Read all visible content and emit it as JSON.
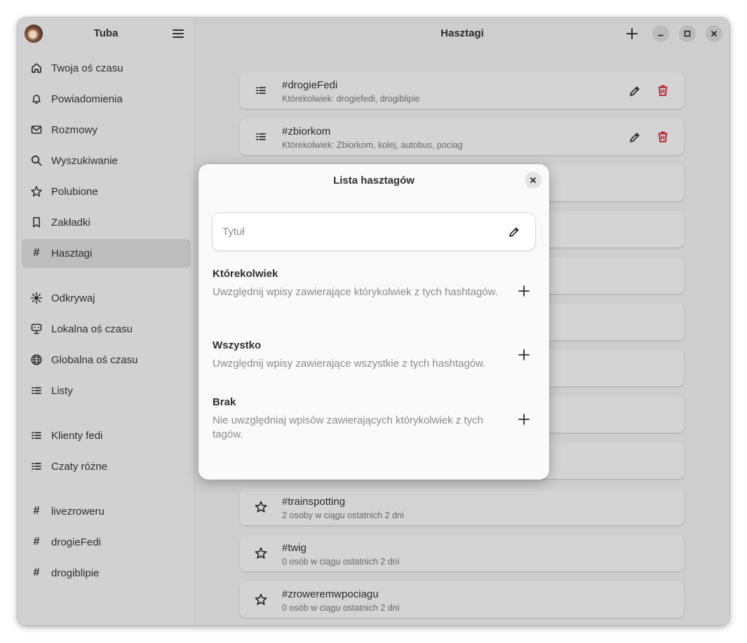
{
  "sidebar": {
    "title": "Tuba",
    "items": [
      {
        "label": "Twoja oś czasu",
        "icon": "home-icon"
      },
      {
        "label": "Powiadomienia",
        "icon": "bell-icon"
      },
      {
        "label": "Rozmowy",
        "icon": "mail-icon"
      },
      {
        "label": "Wyszukiwanie",
        "icon": "search-icon"
      },
      {
        "label": "Polubione",
        "icon": "star-icon"
      },
      {
        "label": "Zakładki",
        "icon": "bookmark-icon"
      },
      {
        "label": "Hasztagi",
        "icon": "hashtag-icon",
        "active": true
      },
      {
        "label": "Odkrywaj",
        "icon": "explore-icon"
      },
      {
        "label": "Lokalna oś czasu",
        "icon": "local-timeline-icon"
      },
      {
        "label": "Globalna oś czasu",
        "icon": "globe-icon"
      },
      {
        "label": "Listy",
        "icon": "list-icon"
      },
      {
        "label": "Klienty fedi",
        "icon": "list-icon"
      },
      {
        "label": "Czaty różne",
        "icon": "list-icon"
      },
      {
        "label": "livezroweru",
        "icon": "hashtag-icon"
      },
      {
        "label": "drogieFedi",
        "icon": "hashtag-icon"
      },
      {
        "label": "drogiblipie",
        "icon": "hashtag-icon"
      }
    ]
  },
  "main": {
    "title": "Hasztagi",
    "cards_top": [
      {
        "title": "#drogieFedi",
        "subtitle": "Którekolwiek: drogiefedi, drogiblipie"
      },
      {
        "title": "#zbiorkom",
        "subtitle": "Którekolwiek: Zbiorkom, kolej, autobus, pociag"
      }
    ],
    "cards_bottom": [
      {
        "title": "#trainspotting",
        "subtitle": "2 osoby w ciągu ostatnich 2 dni"
      },
      {
        "title": "#twig",
        "subtitle": "0 osób w ciągu ostatnich 2 dni"
      },
      {
        "title": "#zroweremwpociagu",
        "subtitle": "0 osób w ciągu ostatnich 2 dni"
      }
    ]
  },
  "dialog": {
    "title": "Lista hasztagów",
    "title_placeholder": "Tytuł",
    "sections": [
      {
        "title": "Którekolwiek",
        "desc": "Uwzględnij wpisy zawierające którykolwiek z tych hashtagów."
      },
      {
        "title": "Wszystko",
        "desc": "Uwzględnij wpisy zawierające wszystkie z tych hashtagów."
      },
      {
        "title": "Brak",
        "desc": "Nie uwzględniaj wpisów zawierających którykolwiek z tych tagów."
      }
    ]
  },
  "colors": {
    "danger": "#c01c28",
    "sidebar_bg": "#d1d1d1",
    "main_bg": "#dadada",
    "dialog_bg": "#fafafa"
  }
}
